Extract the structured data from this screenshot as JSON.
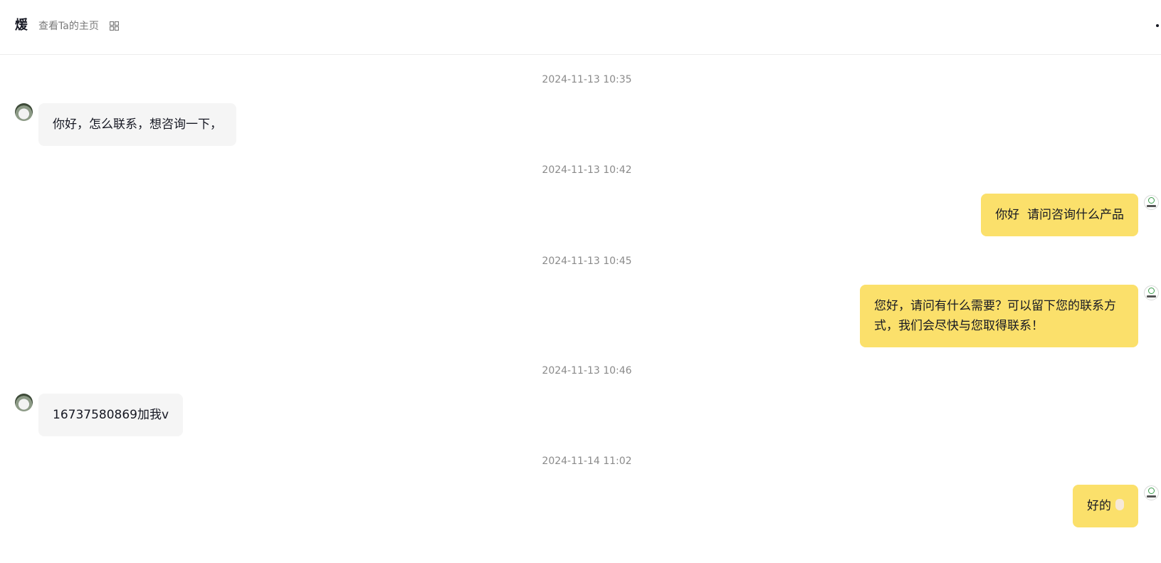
{
  "header": {
    "contact_name": "煖",
    "profile_link": "查看Ta的主页",
    "grid_icon": "grid-icon",
    "more_icon": "more-dot-icon"
  },
  "messages": [
    {
      "timestamp": "2024-11-13 10:35",
      "side": "left",
      "text": "你好，怎么联系，想咨询一下，"
    },
    {
      "timestamp": "2024-11-13 10:42",
      "side": "right",
      "text": "你好  请问咨询什么产品"
    },
    {
      "timestamp": "2024-11-13 10:45",
      "side": "right",
      "text": "您好，请问有什么需要？可以留下您的联系方式，我们会尽快与您取得联系！"
    },
    {
      "timestamp": "2024-11-13 10:46",
      "side": "left",
      "text": "16737580869加我v"
    },
    {
      "timestamp": "2024-11-14 11:02",
      "side": "right",
      "text": "好的",
      "emoji": "hand-emoji"
    }
  ],
  "colors": {
    "outgoing_bubble": "#fbe06b",
    "incoming_bubble": "#f5f5f5",
    "timestamp_text": "#8a8a8a"
  }
}
